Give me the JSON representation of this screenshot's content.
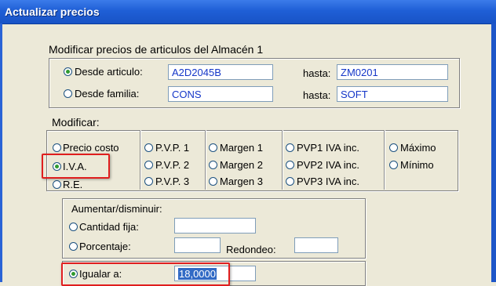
{
  "window": {
    "title": "Actualizar precios"
  },
  "main": {
    "heading": "Modificar precios de articulos del Almacén 1",
    "range": {
      "desde_articulo_label": "Desde articulo:",
      "desde_articulo_value": "A2D2045B",
      "hasta1_label": "hasta:",
      "hasta1_value": "ZM0201",
      "desde_familia_label": "Desde familia:",
      "desde_familia_value": "CONS",
      "hasta2_label": "hasta:",
      "hasta2_value": "SOFT",
      "selected": "Desde articulo:"
    },
    "modificar": {
      "label": "Modificar:",
      "options": {
        "precio_costo": "Precio costo",
        "iva": "I.V.A.",
        "re": "R.E.",
        "pvp1": "P.V.P. 1",
        "pvp2": "P.V.P. 2",
        "pvp3": "P.V.P. 3",
        "margen1": "Margen 1",
        "margen2": "Margen 2",
        "margen3": "Margen 3",
        "pvp1_iva": "PVP1 IVA inc.",
        "pvp2_iva": "PVP2 IVA inc.",
        "pvp3_iva": "PVP3 IVA inc.",
        "maximo": "Máximo",
        "minimo": "Mínimo"
      },
      "selected": "I.V.A."
    },
    "ajuste": {
      "label": "Aumentar/disminuir:",
      "cantidad_fija_label": "Cantidad fija:",
      "cantidad_fija_value": "",
      "porcentaje_label": "Porcentaje:",
      "porcentaje_value": "",
      "redondeo_label": "Redondeo:",
      "redondeo_value": "",
      "igualar_label": "Igualar a:",
      "igualar_value": "18,0000",
      "selected": "Igualar a:"
    },
    "colors": {
      "highlight": "#e01e1e",
      "titlebar": "#1f5fd6",
      "field_text": "#1436c8"
    }
  }
}
